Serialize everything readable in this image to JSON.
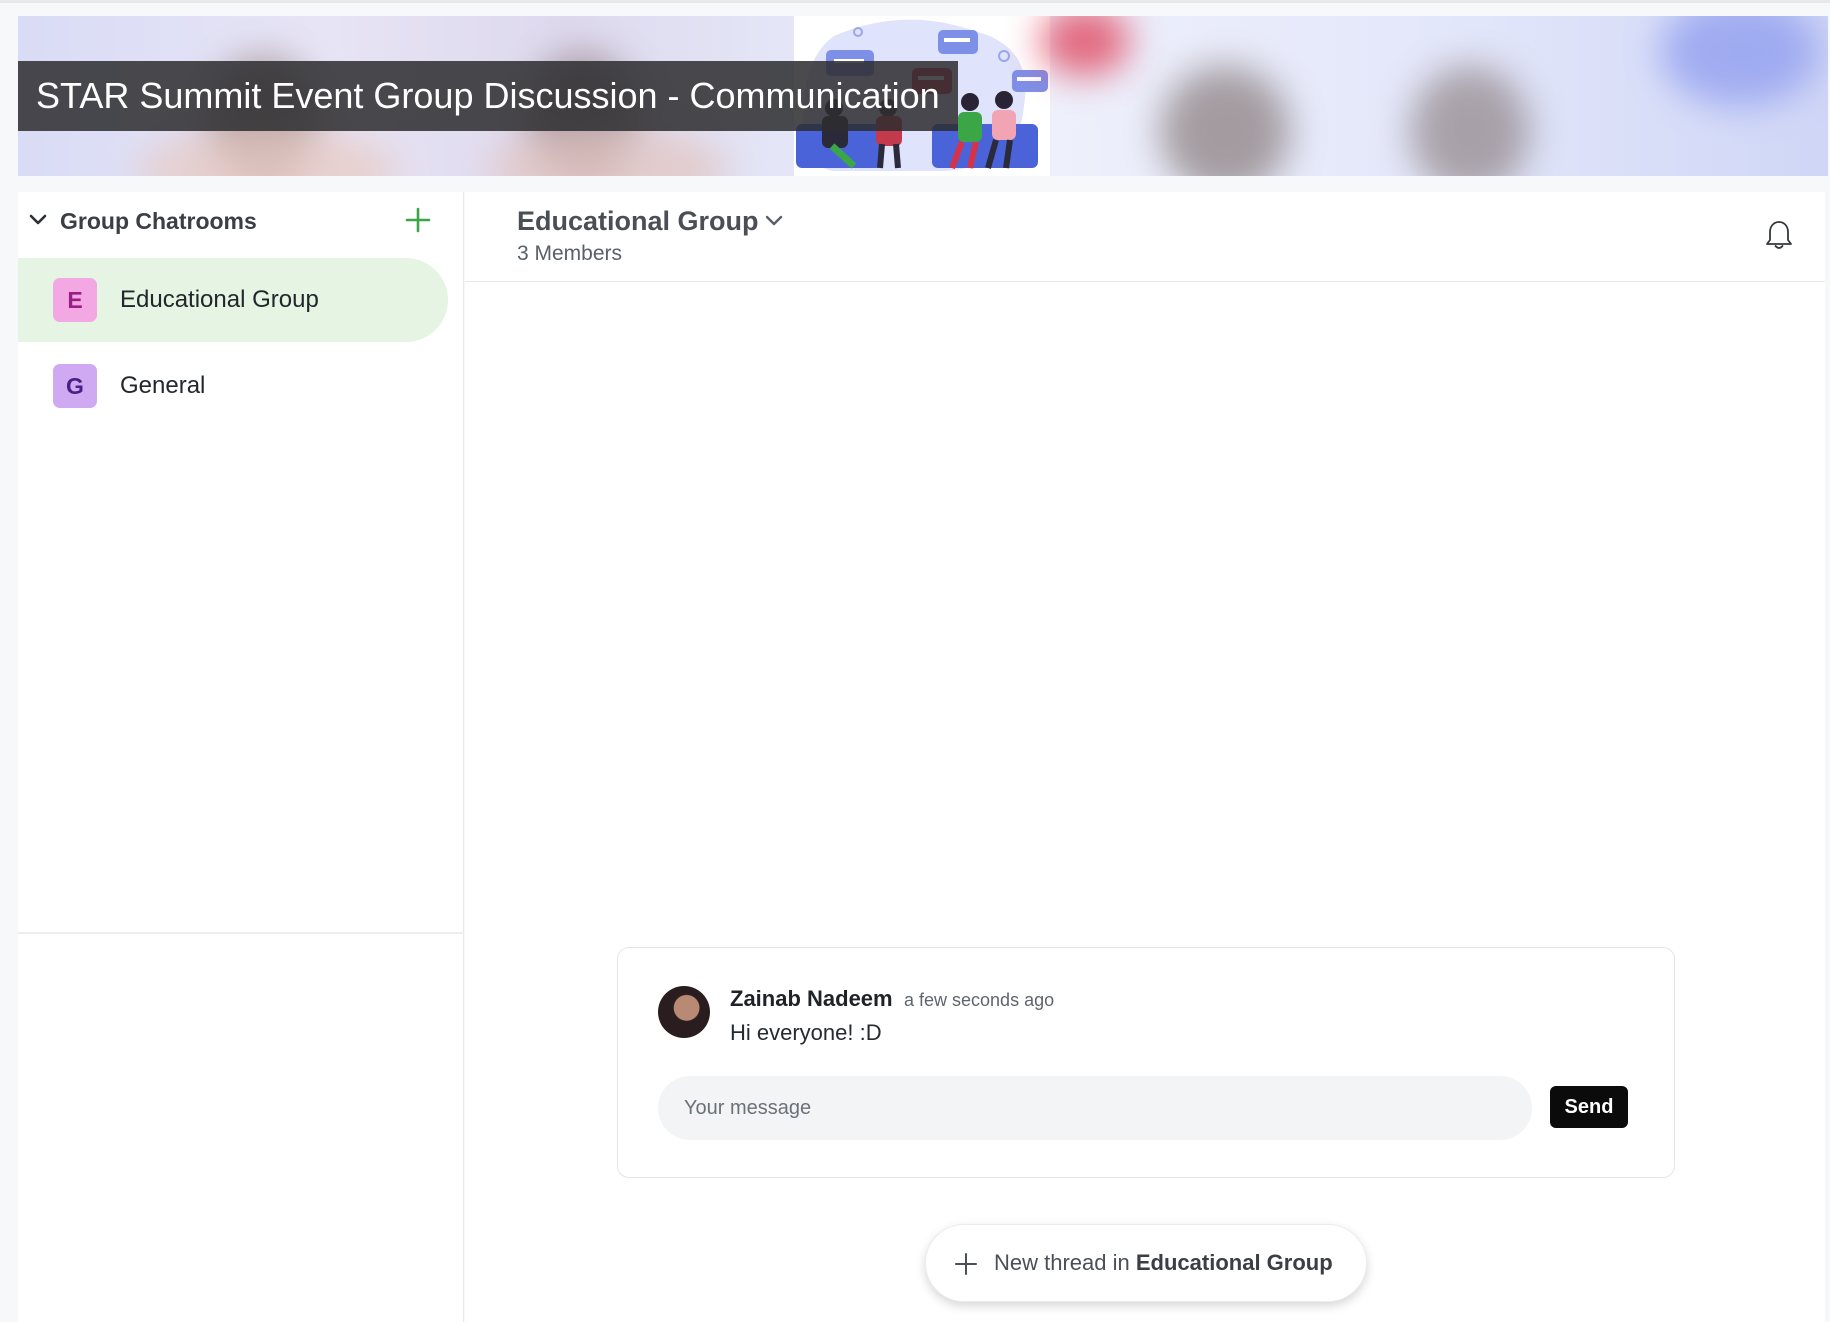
{
  "banner": {
    "title": "STAR Summit Event Group Discussion - Communication"
  },
  "sidebar": {
    "section_title": "Group Chatrooms",
    "rooms": [
      {
        "initial": "E",
        "label": "Educational Group",
        "active": true,
        "avatar_bg": "#f3a7e3",
        "avatar_fg": "#9a1e86"
      },
      {
        "initial": "G",
        "label": "General",
        "active": false,
        "avatar_bg": "#cfa9f2",
        "avatar_fg": "#4b1f86"
      }
    ]
  },
  "main": {
    "group_name": "Educational Group",
    "members": "3 Members",
    "thread": {
      "author": "Zainab Nadeem",
      "timestamp": "a few seconds ago",
      "message": "Hi everyone! :D",
      "input_placeholder": "Your message",
      "send_label": "Send"
    },
    "new_thread": {
      "prefix": "New thread in",
      "group": "Educational Group"
    }
  },
  "colors": {
    "accent_green": "#3aa646",
    "active_room_bg": "#e5f4e3",
    "send_button_bg": "#0b0b0b"
  }
}
